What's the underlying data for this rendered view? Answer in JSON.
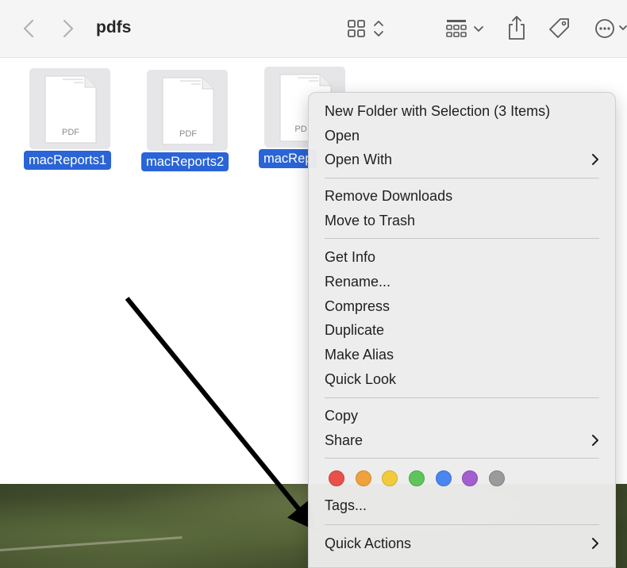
{
  "window": {
    "title": "pdfs"
  },
  "toolbar": {
    "back_icon": "chevron-left-icon",
    "forward_icon": "chevron-right-icon",
    "view_icon": "icon-grid-view-icon",
    "group_icon": "group-by-icon",
    "share_icon": "share-icon",
    "tag_icon": "tag-icon",
    "more_icon": "ellipsis-circle-icon"
  },
  "files": [
    {
      "name": "macReports1",
      "thumb_text": "PDF"
    },
    {
      "name": "macReports2",
      "thumb_text": "PDF"
    },
    {
      "name": "macRep",
      "thumb_text": "PD"
    }
  ],
  "context_menu": {
    "items": [
      {
        "label": "New Folder with Selection (3 Items)"
      },
      {
        "label": "Open"
      },
      {
        "label": "Open With",
        "submenu": true
      },
      {
        "label": "Remove Downloads"
      },
      {
        "label": "Move to Trash"
      },
      {
        "label": "Get Info"
      },
      {
        "label": "Rename..."
      },
      {
        "label": "Compress"
      },
      {
        "label": "Duplicate"
      },
      {
        "label": "Make Alias"
      },
      {
        "label": "Quick Look"
      },
      {
        "label": "Copy"
      },
      {
        "label": "Share",
        "submenu": true
      },
      {
        "label": "Tags..."
      },
      {
        "label": "Quick Actions",
        "submenu": true
      }
    ],
    "tag_colors": [
      {
        "name": "red",
        "color": "#e9504a"
      },
      {
        "name": "orange",
        "color": "#efa13b"
      },
      {
        "name": "yellow",
        "color": "#f2cb3c"
      },
      {
        "name": "green",
        "color": "#5ec45c"
      },
      {
        "name": "blue",
        "color": "#4a86ef"
      },
      {
        "name": "purple",
        "color": "#a15fd0"
      },
      {
        "name": "gray",
        "color": "#9a9a9c"
      }
    ]
  },
  "colors": {
    "selection": "#2a64d6",
    "menu_background": "#ececec",
    "arrow": "#000000"
  }
}
